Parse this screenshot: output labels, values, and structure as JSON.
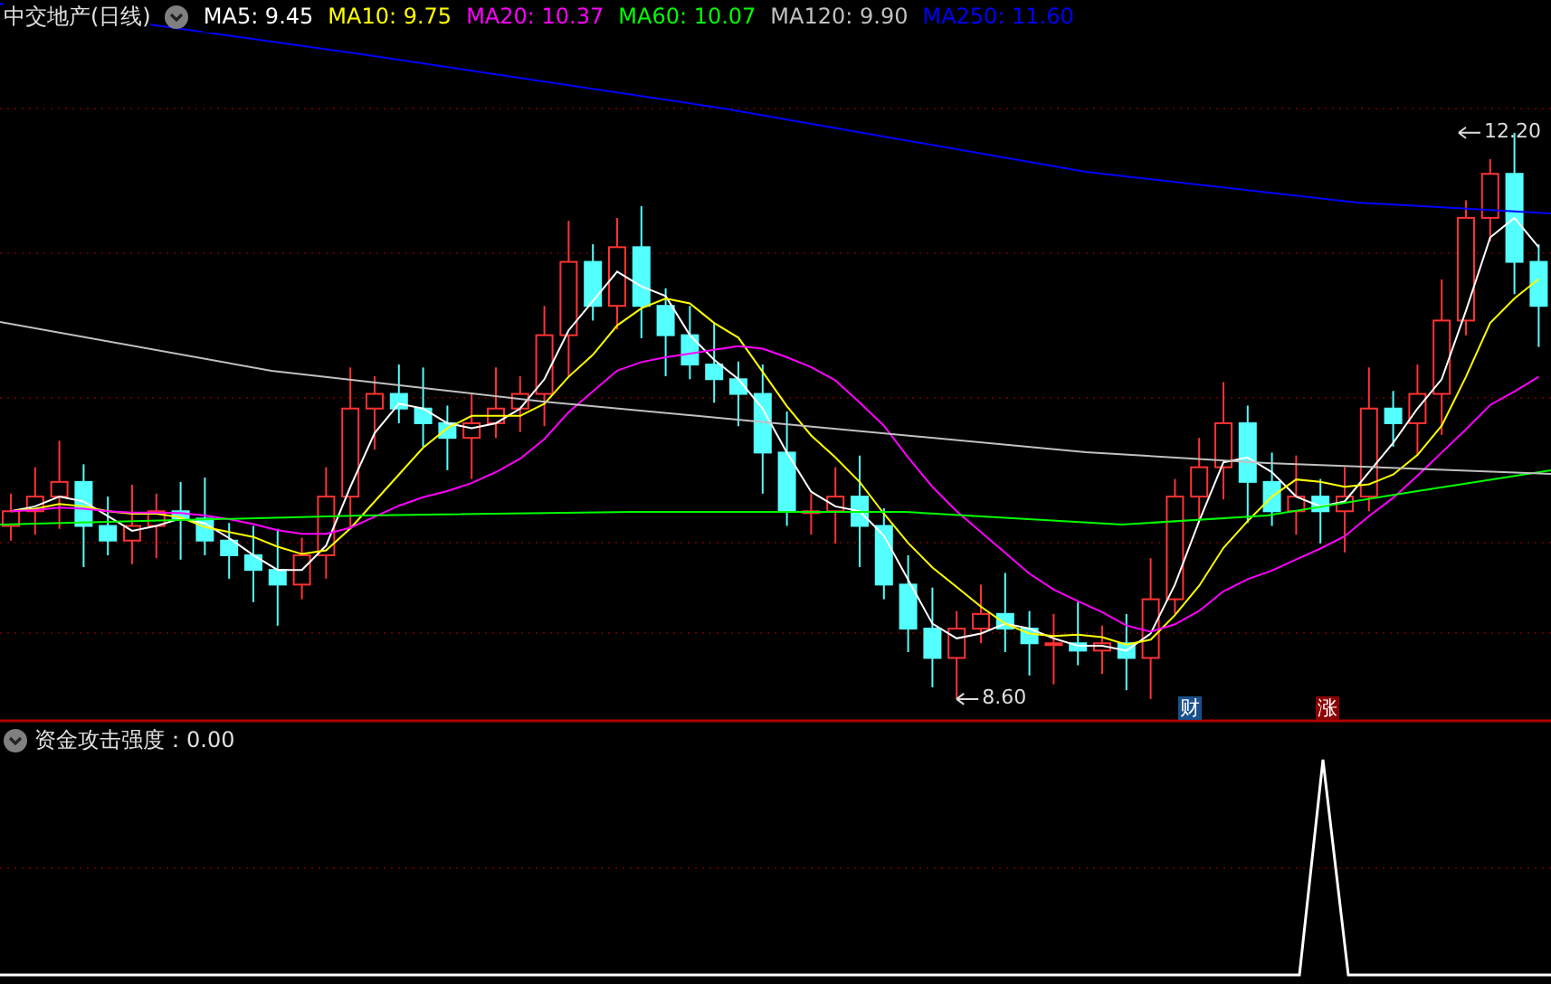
{
  "title": "中交地产(日线)",
  "indicators": [
    {
      "label": "MA5: 9.45",
      "color": "#ffffff"
    },
    {
      "label": "MA10: 9.75",
      "color": "#ffff00"
    },
    {
      "label": "MA20: 10.37",
      "color": "#ff00ff"
    },
    {
      "label": "MA60: 10.07",
      "color": "#00ff00"
    },
    {
      "label": "MA120: 9.90",
      "color": "#c0c0c0"
    },
    {
      "label": "MA250: 11.60",
      "color": "#0000ff"
    }
  ],
  "price_marks": [
    {
      "kind": "high",
      "text": "12.20"
    },
    {
      "kind": "low",
      "text": "8.60"
    }
  ],
  "event_badges": [
    {
      "text": "财",
      "color": "#1a4f8a"
    },
    {
      "text": "涨",
      "color": "#8b0000"
    }
  ],
  "lower_panel": {
    "title": "资金攻击强度：0.00"
  }
}
